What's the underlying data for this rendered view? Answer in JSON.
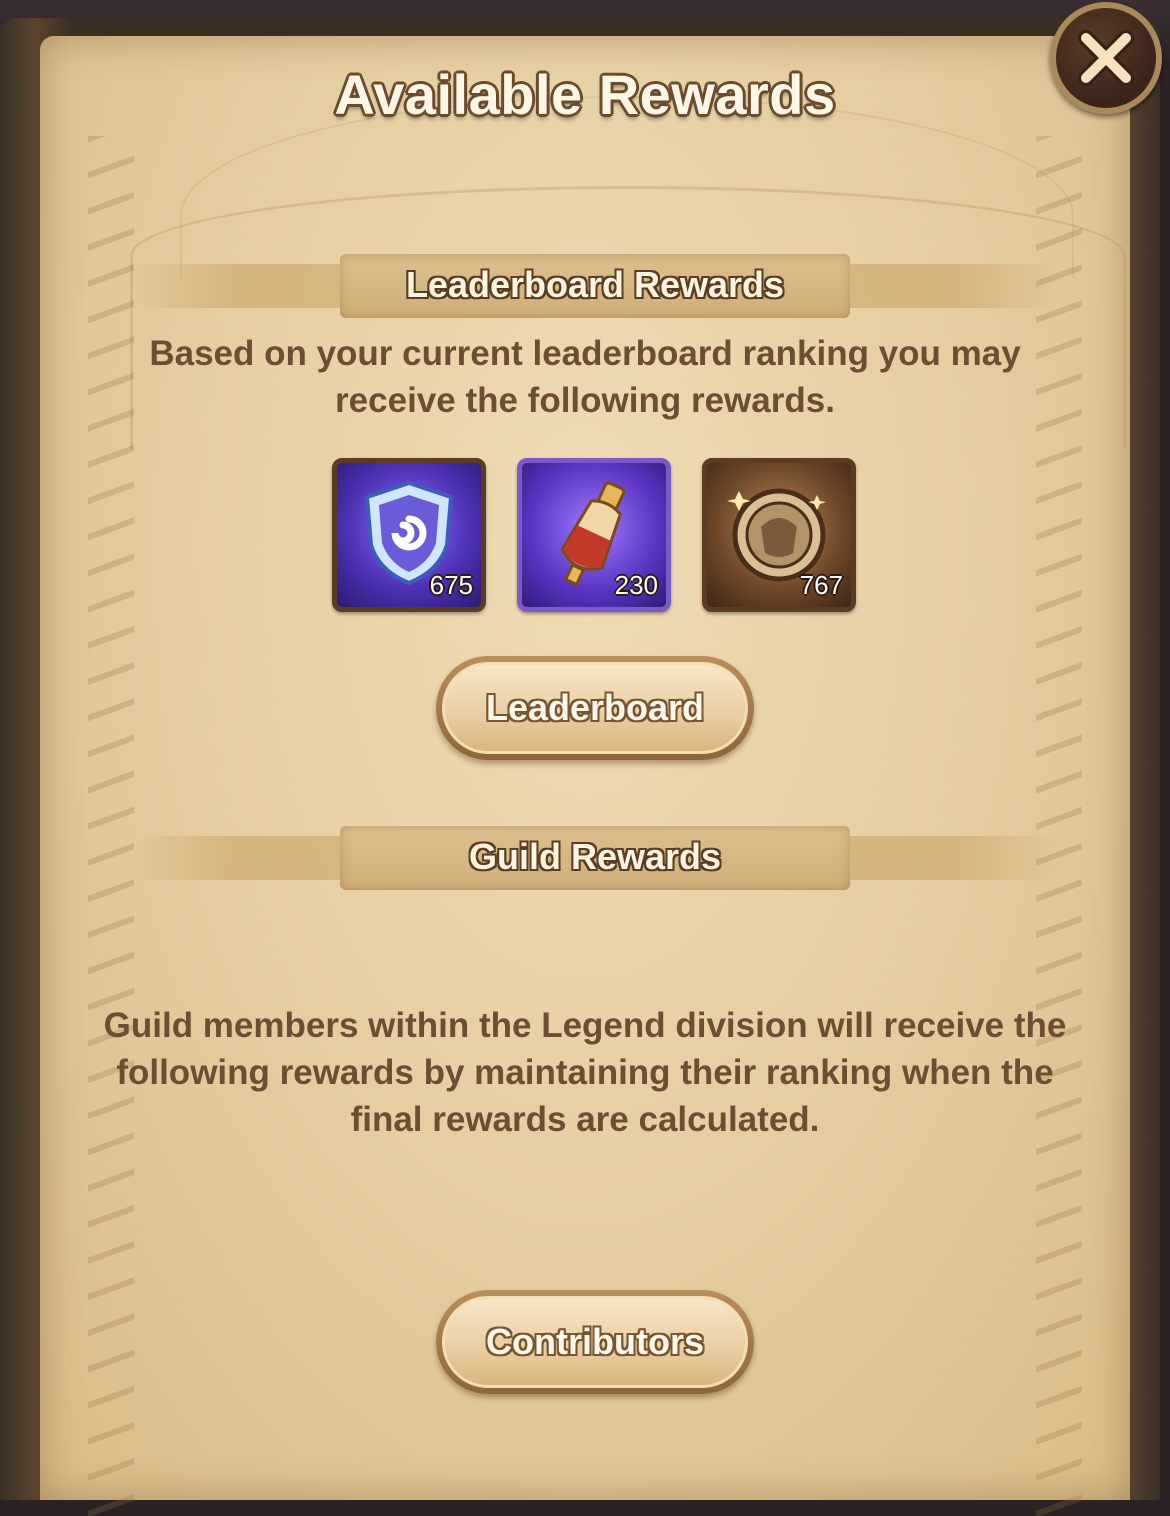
{
  "dialog": {
    "title": "Available Rewards",
    "close_icon": "close-icon"
  },
  "leaderboard_section": {
    "heading": "Leaderboard Rewards",
    "description": "Based on your current leaderboard ranking you may receive the following rewards.",
    "rewards": [
      {
        "icon": "shield-emblem-icon",
        "count": "675"
      },
      {
        "icon": "potion-vial-icon",
        "count": "230"
      },
      {
        "icon": "hero-medallion-icon",
        "count": "767"
      }
    ],
    "button_label": "Leaderboard"
  },
  "guild_section": {
    "heading": "Guild Rewards",
    "description": "Guild members within the Legend division will receive the following rewards by maintaining their ranking when the final rewards are calculated.",
    "button_label": "Contributors"
  },
  "colors": {
    "parchment": "#e6cfa2",
    "text_brown": "#6e4e32",
    "outline_brown": "#5b3d25"
  }
}
